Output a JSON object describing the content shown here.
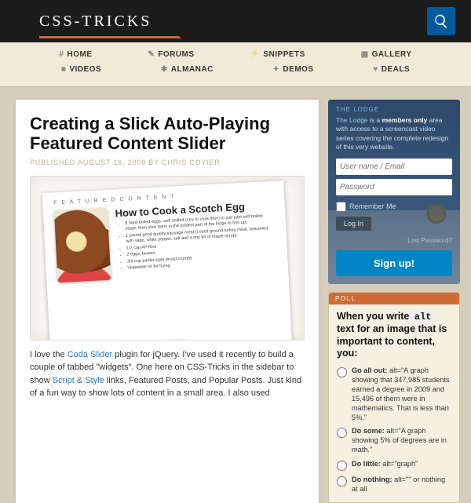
{
  "site": {
    "logo": "CSS-TRICKS"
  },
  "nav": {
    "row1": [
      {
        "label": "HOME",
        "icon": "#"
      },
      {
        "label": "FORUMS",
        "icon": "✎"
      },
      {
        "label": "SNIPPETS",
        "icon": "⚡"
      },
      {
        "label": "GALLERY",
        "icon": "▦"
      }
    ],
    "row2": [
      {
        "label": "VIDEOS",
        "icon": "■"
      },
      {
        "label": "ALMANAC",
        "icon": "✱"
      },
      {
        "label": "DEMOS",
        "icon": "✦"
      },
      {
        "label": "DEALS",
        "icon": "♥"
      }
    ]
  },
  "article": {
    "title": "Creating a Slick Auto-Playing Featured Content Slider",
    "published_prefix": "PUBLISHED ",
    "published_date": "AUGUST 18, 2008",
    "by": " BY ",
    "author": "CHRIS COYIER",
    "screenshot": {
      "tag": "F E A T U R E D   C O N T E N T",
      "heading": "How to Cook a Scotch Egg",
      "bullets": [
        "8 hard-boiled eggs, well chilled (I try to cook them to just past soft boiled stage, then stick them in the coldest part of the fridge to firm up)",
        "1 pound good quality sausage meat (I used ground turkey meat, seasoned with sage, white pepper, salt and a tiny bit of maple syrup)",
        "1/2 cup AP flour",
        "2 eggs, beaten",
        "3/4 cup panko-style bread crumbs",
        "Vegetable oil for frying"
      ]
    },
    "body_parts": {
      "p1a": "I love the ",
      "link1": "Coda Slider",
      "p1b": " plugin for jQuery. I've used it recently to build a couple of tabbed \"widgets\". One here on CSS-Tricks in the sidebar to show ",
      "link2": "Script & Style",
      "p1c": " links, Featured Posts, and Popular Posts. Just kind of a fun way to show lots of content in a small area. I also used"
    }
  },
  "lodge": {
    "heading": "THE LODGE",
    "blurb_a": "The Lodge",
    "blurb_b": " is a ",
    "blurb_c": "members only",
    "blurb_d": " area with access to a screencast video series covering the complete redesign of this very website.",
    "user_placeholder": "User name / Email",
    "pass_placeholder": "Password",
    "remember": "Remember Me",
    "login": "Log In",
    "lost": "Lost Password?",
    "signup": "Sign up!"
  },
  "poll": {
    "heading": "POLL",
    "question_a": "When you write ",
    "question_code": "alt",
    "question_b": " text for an image that is important to content, you:",
    "options": [
      {
        "bold": "Go all out:",
        "rest": " alt=\"A graph showing that 347,985 students earned a degree in 2009 and 15,496 of them were in mathematics. That is less than 5%.\""
      },
      {
        "bold": "Do some:",
        "rest": " alt=\"A graph showing 5% of degrees are in math.\""
      },
      {
        "bold": "Do little:",
        "rest": " alt=\"graph\""
      },
      {
        "bold": "Do nothing:",
        "rest": " alt=\"\" or nothing at all"
      }
    ]
  }
}
